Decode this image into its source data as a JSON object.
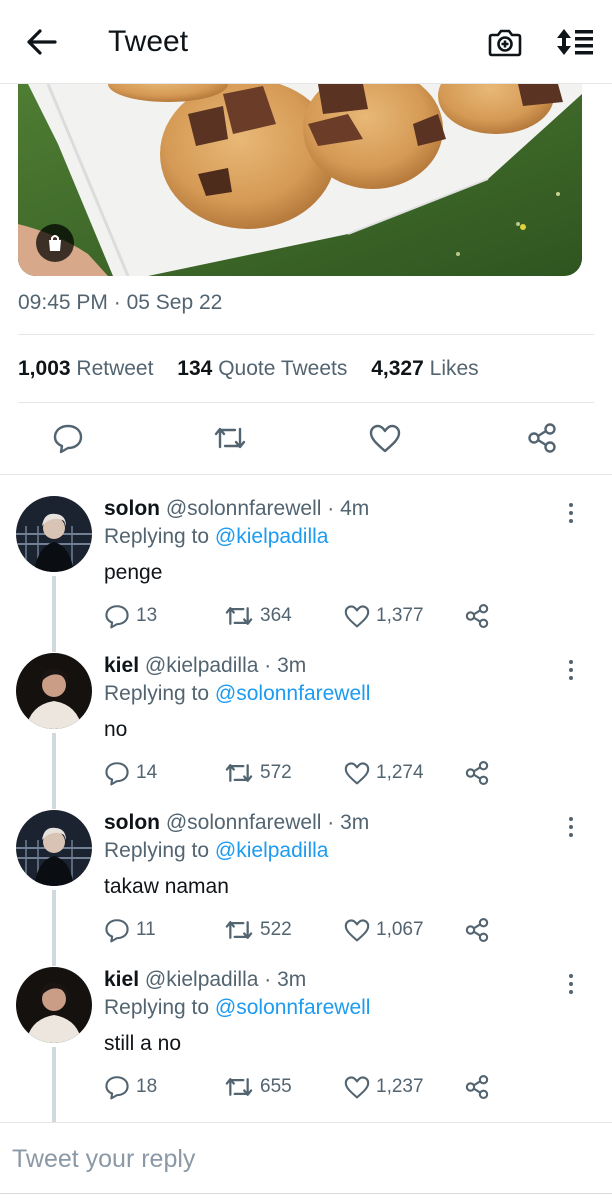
{
  "header": {
    "title": "Tweet",
    "back_icon": "arrow-left-icon",
    "camera_icon": "camera-plus-icon",
    "sort_icon": "sort-timeline-icon"
  },
  "tweet": {
    "media_description_icon": "shopping-bag-icon",
    "time": "09:45 PM",
    "separator": "·",
    "date": "05 Sep 22",
    "stats": {
      "retweets_count": "1,003",
      "retweets_label": "Retweet",
      "quotes_count": "134",
      "quotes_label": "Quote Tweets",
      "likes_count": "4,327",
      "likes_label": "Likes"
    },
    "actions": [
      "reply-icon",
      "retweet-icon",
      "like-icon",
      "share-icon"
    ]
  },
  "replies": [
    {
      "name": "solon",
      "handle": "@solonnfarewell",
      "time": "· 4m",
      "replying_prefix": "Replying to",
      "replying_to": "@kielpadilla",
      "text": "penge",
      "reply_count": "13",
      "retweet_count": "364",
      "like_count": "1,377"
    },
    {
      "name": "kiel",
      "handle": "@kielpadilla",
      "time": "· 3m",
      "replying_prefix": "Replying to",
      "replying_to": "@solonnfarewell",
      "text": "no",
      "reply_count": "14",
      "retweet_count": "572",
      "like_count": "1,274"
    },
    {
      "name": "solon",
      "handle": "@solonnfarewell",
      "time": "· 3m",
      "replying_prefix": "Replying to",
      "replying_to": "@kielpadilla",
      "text": "takaw naman",
      "reply_count": "11",
      "retweet_count": "522",
      "like_count": "1,067"
    },
    {
      "name": "kiel",
      "handle": "@kielpadilla",
      "time": "· 3m",
      "replying_prefix": "Replying to",
      "replying_to": "@solonnfarewell",
      "text": "still a no",
      "reply_count": "18",
      "retweet_count": "655",
      "like_count": "1,237"
    }
  ],
  "composer": {
    "placeholder": "Tweet your reply"
  },
  "colors": {
    "accent": "#1d9bf0",
    "secondary_text": "#536471",
    "primary_text": "#0f1419",
    "divider": "#e6e6e6"
  }
}
